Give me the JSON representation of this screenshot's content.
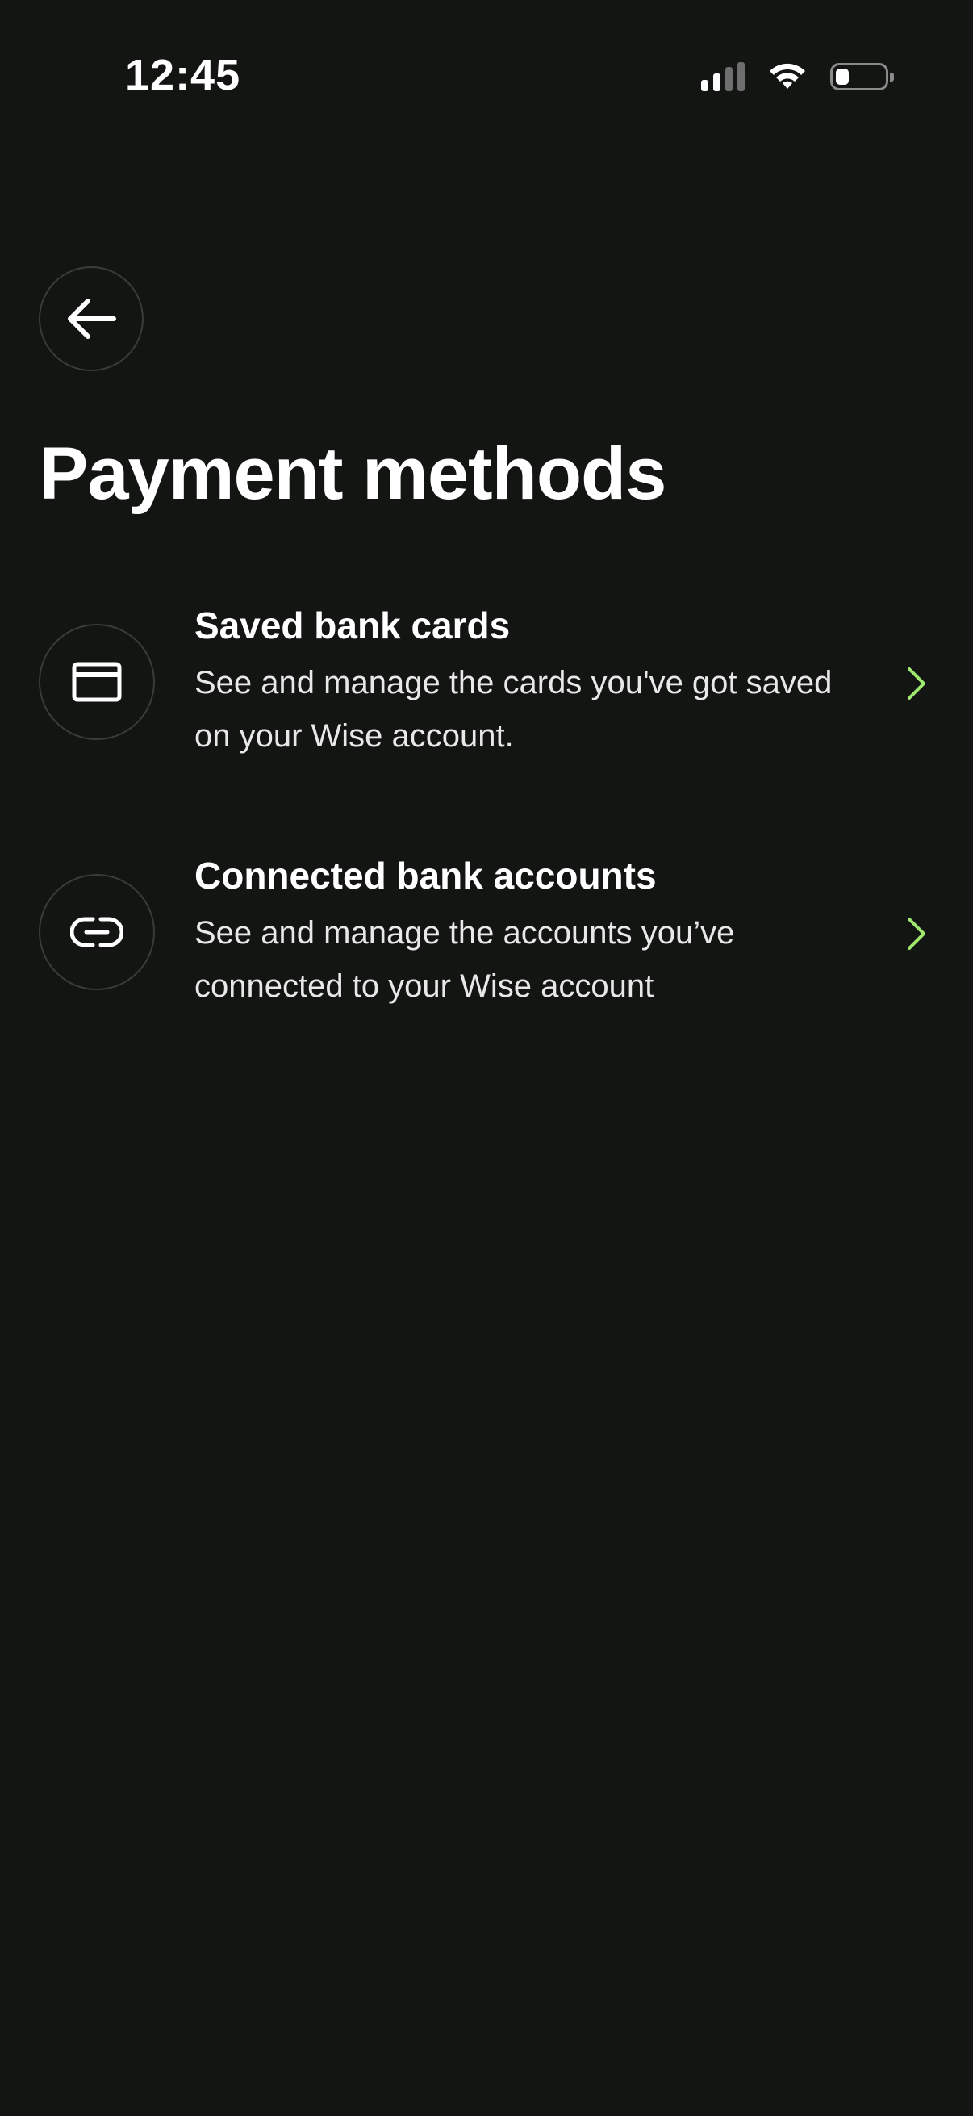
{
  "status_bar": {
    "time": "12:45",
    "icons": [
      "cellular-signal-icon",
      "wifi-icon",
      "battery-icon"
    ]
  },
  "header": {
    "back_icon": "arrow-left-icon",
    "title": "Payment methods"
  },
  "payment_methods": [
    {
      "icon": "credit-card-icon",
      "title": "Saved bank cards",
      "description": "See and manage the cards you've got saved on your Wise account."
    },
    {
      "icon": "link-icon",
      "title": "Connected bank accounts",
      "description": "See and manage the accounts you’ve connected to your Wise account"
    }
  ],
  "colors": {
    "background": "#131513",
    "text_primary": "#ffffff",
    "accent_chevron": "#9fe870",
    "circle_border": "#3a3c3a"
  }
}
